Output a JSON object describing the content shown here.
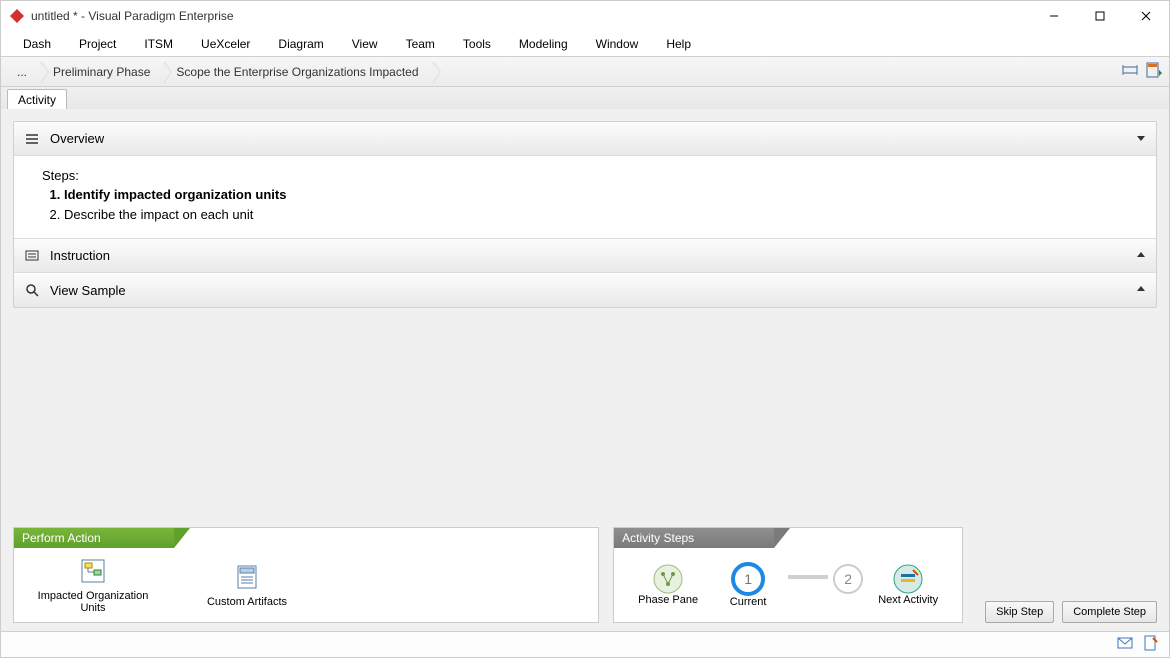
{
  "title": "untitled * - Visual Paradigm Enterprise",
  "menu": [
    "Dash",
    "Project",
    "ITSM",
    "UeXceler",
    "Diagram",
    "View",
    "Team",
    "Tools",
    "Modeling",
    "Window",
    "Help"
  ],
  "breadcrumb": [
    "...",
    "Preliminary Phase",
    "Scope the Enterprise Organizations Impacted"
  ],
  "tab": {
    "label": "Activity"
  },
  "overview": {
    "title": "Overview",
    "steps_label": "Steps:",
    "steps": [
      {
        "text": "Identify impacted organization units",
        "bold": true
      },
      {
        "text": "Describe the impact on each unit",
        "bold": false
      }
    ]
  },
  "instruction": {
    "title": "Instruction"
  },
  "view_sample": {
    "title": "View Sample"
  },
  "perform_action": {
    "title": "Perform Action",
    "items": [
      {
        "label": "Impacted Organization Units"
      },
      {
        "label": "Custom Artifacts"
      }
    ]
  },
  "activity_steps": {
    "title": "Activity Steps",
    "phase_pane": "Phase Pane",
    "current": "Current",
    "step1": "1",
    "step2": "2",
    "next_activity": "Next Activity"
  },
  "buttons": {
    "skip": "Skip Step",
    "complete": "Complete Step"
  }
}
